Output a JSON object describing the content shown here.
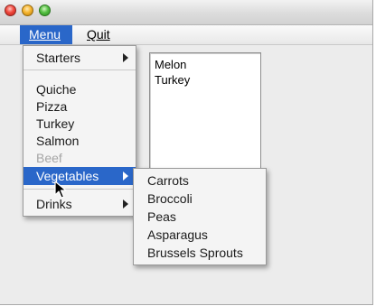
{
  "window": {
    "traffic_lights": [
      "close",
      "minimize",
      "zoom"
    ]
  },
  "menubar": {
    "items": [
      {
        "label": "Menu"
      },
      {
        "label": "Quit"
      }
    ]
  },
  "listbox": {
    "items": [
      "Melon",
      "Turkey"
    ]
  },
  "menu": {
    "items": [
      {
        "label": "Starters",
        "submenu": true,
        "enabled": true
      },
      {
        "label": "Quiche",
        "enabled": true
      },
      {
        "label": "Pizza",
        "enabled": true
      },
      {
        "label": "Turkey",
        "enabled": true
      },
      {
        "label": "Salmon",
        "enabled": true
      },
      {
        "label": "Beef",
        "enabled": false
      },
      {
        "label": "Vegetables",
        "submenu": true,
        "enabled": true,
        "selected": true
      },
      {
        "label": "Drinks",
        "submenu": true,
        "enabled": true
      }
    ]
  },
  "submenu": {
    "items": [
      "Carrots",
      "Broccoli",
      "Peas",
      "Asparagus",
      "Brussels Sprouts"
    ]
  },
  "colors": {
    "selection": "#2a67c9",
    "disabled_text": "#a5a5a5"
  },
  "icons": {
    "cursor": "arrow-pointer-icon",
    "submenu_indicator": "triangle-right-icon"
  }
}
